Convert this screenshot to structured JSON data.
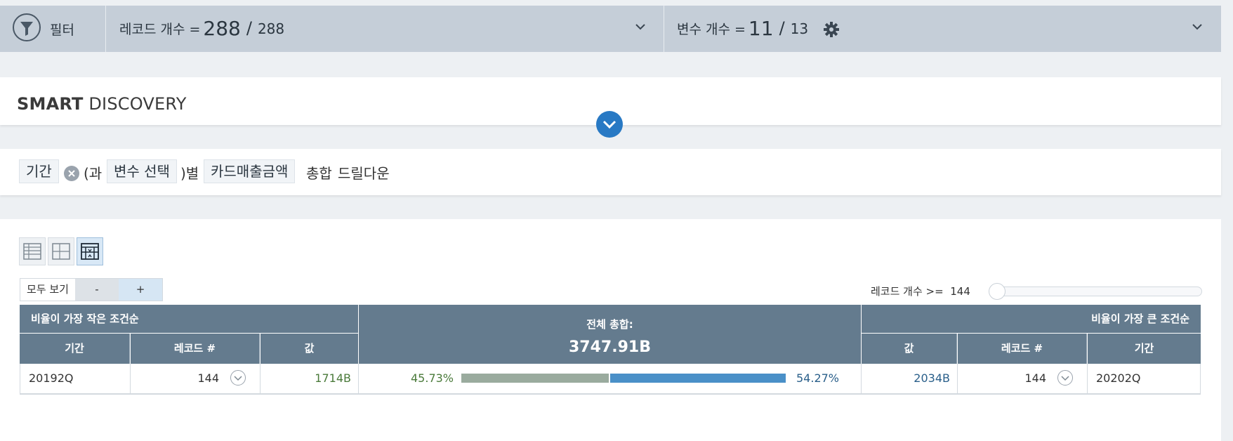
{
  "topbar": {
    "filter_label": "필터",
    "records_label": "레코드 개수 =",
    "records_selected": "288",
    "records_slash": "/",
    "records_total": "288",
    "vars_label": "변수 개수 =",
    "vars_selected": "11",
    "vars_slash": "/",
    "vars_total": "13"
  },
  "smart_discovery": {
    "title_bold": "SMART",
    "title_rest": "DISCOVERY"
  },
  "query": {
    "chip_period": "기간",
    "text_with": "(과",
    "chip_variable": "변수 선택",
    "text_by": ")별",
    "chip_measure": "카드매출금액",
    "text_total": "총합",
    "text_drilldown": "드릴다운"
  },
  "controls": {
    "show_all": "모두 보기",
    "minus": "-",
    "plus": "+",
    "record_count_label": "레코드 개수 >=",
    "record_count_value": "144",
    "slider_min_fraction": 0
  },
  "table": {
    "left_header": "비율이 가장 작은 조건순",
    "right_header": "비율이 가장 큰 조건순",
    "total_label": "전체 총합:",
    "total_value": "3747.91B",
    "left_cols": [
      "기간",
      "레코드 #",
      "값"
    ],
    "right_cols": [
      "값",
      "레코드 #",
      "기간"
    ],
    "row": {
      "left_period": "20192Q",
      "left_records": "144",
      "left_value": "1714B",
      "left_pct": "45.73%",
      "right_pct": "54.27%",
      "left_fraction": 0.4573,
      "right_fraction": 0.5427,
      "right_value": "2034B",
      "right_records": "144",
      "right_period": "20202Q"
    }
  },
  "colors": {
    "header_bg": "#647b8e",
    "topbar_bg": "#c5ced8",
    "left_value_color": "#4a7a3a",
    "right_value_color": "#2a5f8a",
    "bar_left": "#9aab9e",
    "bar_right": "#4a90c8",
    "accent": "#2879c4"
  },
  "icons": {
    "filter": "filter-funnel-icon",
    "dropdown": "chevron-down-icon",
    "settings": "gear-icon",
    "expand": "chevron-down-circle-icon",
    "remove": "close-circle-icon",
    "drilldown": "chevron-down-circle-icon"
  }
}
